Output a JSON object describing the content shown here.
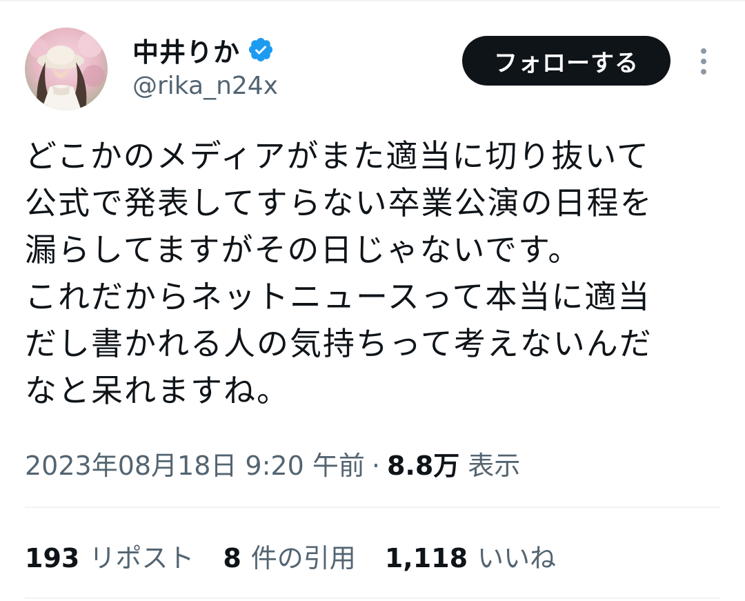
{
  "user": {
    "display_name": "中井りか",
    "handle": "@rika_n24x",
    "verified_icon": "verified-badge-icon",
    "avatar": "profile-photo"
  },
  "actions": {
    "follow_label": "フォローする",
    "more_icon": "more-vertical-icon"
  },
  "tweet": {
    "text": "どこかのメディアがまた適当に切り抜いて\n公式で発表してすらない卒業公演の日程を\n漏らしてますがその日じゃないです。\nこれだからネットニュースって本当に適当\nだし書かれる人の気持ちって考えないんだ\nなと呆れますね。"
  },
  "meta": {
    "date": "2023年08月18日",
    "time": "9:20 午前",
    "separator": "·",
    "views_count": "8.8万",
    "views_label": "表示"
  },
  "stats": [
    {
      "count": "193",
      "label": "リポスト"
    },
    {
      "count": "8",
      "label": "件の引用"
    },
    {
      "count": "1,118",
      "label": "いいね"
    }
  ],
  "colors": {
    "text_primary": "#0f1419",
    "text_secondary": "#536471",
    "verified_blue": "#1d9bf0",
    "divider": "#eff3f4",
    "button_bg": "#0f1419"
  }
}
